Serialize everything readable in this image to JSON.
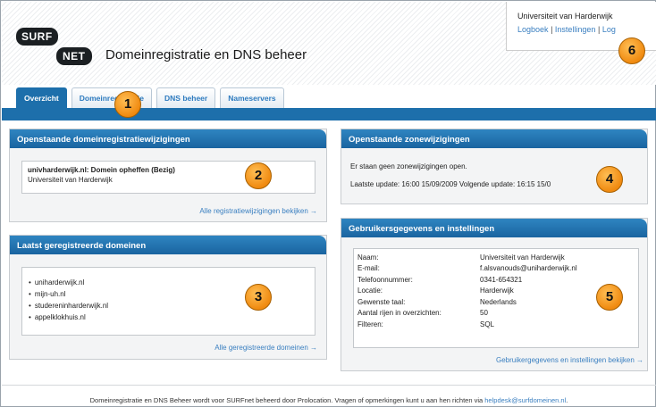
{
  "header": {
    "logo_top": "SURF",
    "logo_bottom": "NET",
    "title": "Domeinregistratie en DNS beheer",
    "org": "Universiteit van Harderwijk",
    "links": [
      "Logboek",
      "Instellingen",
      "Log"
    ]
  },
  "tabs": [
    "Overzicht",
    "Domeinregistratie",
    "DNS beheer",
    "Nameservers"
  ],
  "pending_registrations": {
    "title": "Openstaande domeinregistratiewijzigingen",
    "item_title": "univharderwijk.nl: Domein opheffen (Bezig)",
    "item_sub": "Universiteit van Harderwijk",
    "more": "Alle registratiewijzigingen bekijken →"
  },
  "recent_domains": {
    "title": "Laatst geregistreerde domeinen",
    "items": [
      "uniharderwijk.nl",
      "mijn-uh.nl",
      "studereninharderwijk.nl",
      "appelklokhuis.nl"
    ],
    "more": "Alle geregistreerde domeinen →"
  },
  "pending_zones": {
    "title": "Openstaande zonewijzigingen",
    "line1": "Er staan geen zonewijzigingen open.",
    "line2": "Laatste update: 16:00 15/09/2009 Volgende update: 16:15 15/0"
  },
  "user_settings": {
    "title": "Gebruikersgegevens en instellingen",
    "rows": [
      {
        "label": "Naam:",
        "value": "Universiteit van Harderwijk"
      },
      {
        "label": "E-mail:",
        "value": "f.alsvanouds@uniharderwijk.nl"
      },
      {
        "label": "Telefoonnummer:",
        "value": "0341-654321"
      },
      {
        "label": "Locatie:",
        "value": "Harderwijk"
      },
      {
        "label": "Gewenste taal:",
        "value": "Nederlands"
      },
      {
        "label": "Aantal rijen in overzichten:",
        "value": "50"
      },
      {
        "label": "Filteren:",
        "value": "SQL"
      }
    ],
    "more": "Gebruikergegevens en instellingen bekijken →"
  },
  "badges": [
    "1",
    "2",
    "3",
    "4",
    "5",
    "6"
  ],
  "footer": {
    "text": "Domeinregistratie en DNS Beheer wordt voor SURFnet beheerd door Prolocation. Vragen of opmerkingen kunt u aan hen richten via ",
    "email": "helpdesk@surfdomeinen.nl",
    "end": "."
  }
}
